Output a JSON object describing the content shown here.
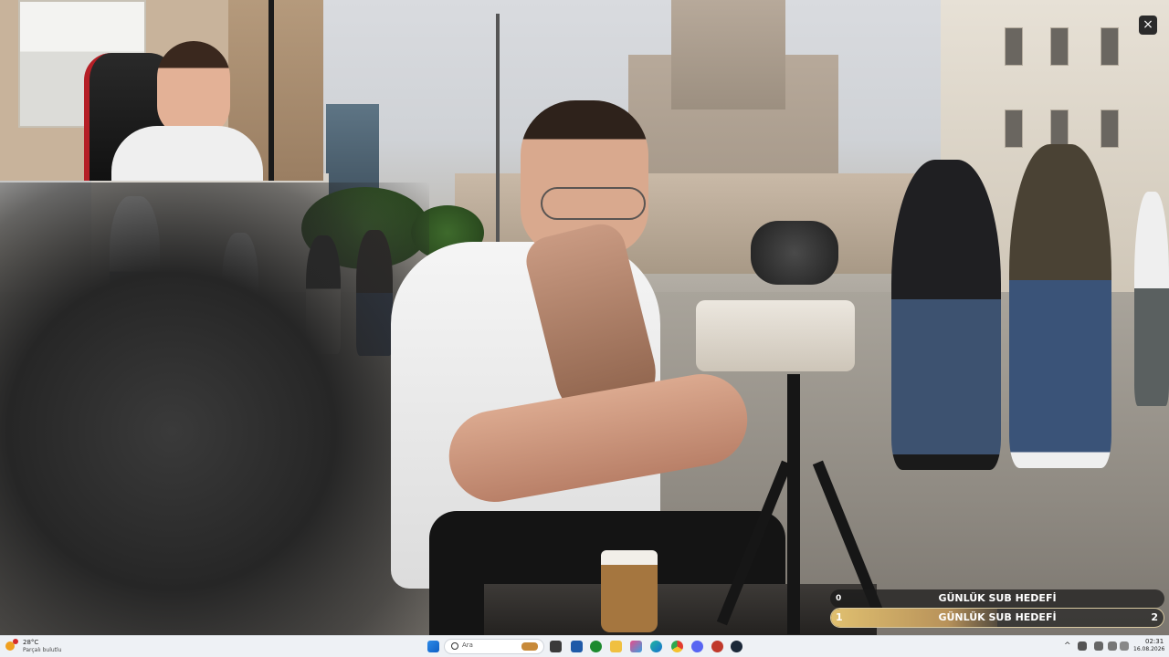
{
  "overlay": {
    "close_glyph": "×"
  },
  "sub_goal": {
    "title": "GÜNLÜK SUB HEDEFİ",
    "current_top": "0",
    "bar_title": "GÜNLÜK SUB HEDEFİ",
    "current": "1",
    "target": "2",
    "progress_fraction": 0.5,
    "accent": "#d9b869"
  },
  "taskbar": {
    "weather_temp": "28°C",
    "weather_desc": "Parçalı bulutlu",
    "search_placeholder": "Ara",
    "clock_time": "02:31",
    "clock_date": "16.08.2026",
    "apps": [
      "start-icon",
      "search-icon",
      "taskview-icon",
      "file-explorer-icon",
      "store-icon",
      "xbox-icon",
      "folder-icon",
      "photos-icon",
      "edge-icon",
      "chrome-icon",
      "discord-icon",
      "media-icon",
      "steam-icon"
    ]
  }
}
